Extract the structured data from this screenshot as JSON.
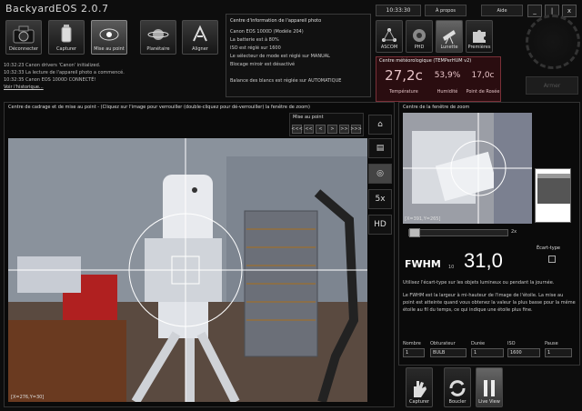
{
  "app": {
    "title": "BackyardEOS 2.0.7"
  },
  "toolbar": {
    "buttons": [
      {
        "label": "Déconnecter"
      },
      {
        "label": "Capturer"
      },
      {
        "label": "Mise au point"
      },
      {
        "label": "Planétaire"
      },
      {
        "label": "Aligner"
      }
    ]
  },
  "log": {
    "lines": [
      "10:32:23   Canon drivers 'Canon' initialized.",
      "10:32:33   La lecture de l'appareil photo a commencé.",
      "10:32:35   Canon EOS 1000D CONNECTÉ!"
    ],
    "history_link": "Voir l'historique..."
  },
  "info_panel": {
    "title": "Centre d'information de l'appareil photo",
    "lines": [
      "Canon EOS 1000D     (Modèle 204)",
      "La batterie est à 80%",
      "ISO est réglé sur 1600",
      "Le sélecteur de mode est réglé sur MANUAL",
      "Blocage miroir est désactivé",
      "",
      "Balance des blancs est réglée sur AUTOMATIQUE"
    ]
  },
  "header_right": {
    "time": "10:33:30",
    "about": "À propos",
    "help": "Aide",
    "win_min": "_",
    "win_max": "|",
    "win_close": "x"
  },
  "modules": [
    {
      "label": "ASCOM"
    },
    {
      "label": "PHD"
    },
    {
      "label": "Lunette"
    },
    {
      "label": "Premières"
    }
  ],
  "meteo": {
    "title": "Centre météorologique (TEMPerHUM v2)",
    "temperature": "27,2c",
    "temperature_label": "Température",
    "humidity": "53,9%",
    "humidity_label": "Humidité",
    "dewpoint": "17,0c",
    "dewpoint_label": "Point de Rosée"
  },
  "armer": {
    "label": "Armer"
  },
  "framing": {
    "title": "Centre de cadrage et de mise au point - (Cliquez sur l'image pour verrouiller (double-cliquez pour dé-verrouiller) la fenêtre de zoom)",
    "coords": "[X=276,Y=30]",
    "mise_title": "Mise au point",
    "mise_buttons": [
      "<<<",
      "<<",
      "<",
      ">",
      ">>",
      ">>>"
    ],
    "side_tools": [
      "⌂",
      "▤",
      "◎",
      "5x",
      "HD"
    ]
  },
  "zoom": {
    "title": "Centre de la fenêtre de zoom",
    "coords": "[X=391,Y=265]",
    "slider_value": "2x",
    "slider_position": 0.0
  },
  "fwhm": {
    "label": "FWHM",
    "sub": "10",
    "value": "31,0",
    "ecart_label": "Écart-type"
  },
  "description": {
    "p1": "Utilisez l'écart-type sur les objets lumineux ou pendant la journée.",
    "p2": "Le FWHM est la largeur à mi-hauteur de l'image de l'étoile. La mise au point est atteinte quand vous obtenez la valeur la plus basse pour la même étoile au fil du temps, ce qui indique une étoile plus fine."
  },
  "params": {
    "nombre_label": "Nombre",
    "nombre": "1",
    "obturateur_label": "Obturateur",
    "obturateur": "BULB",
    "duree_label": "Durée",
    "duree": "1",
    "iso_label": "ISO",
    "iso": "1600",
    "pause_label": "Pause",
    "pause": "1"
  },
  "bottom_buttons": [
    {
      "label": "Capturer"
    },
    {
      "label": "Boucler"
    },
    {
      "label": "Live View"
    }
  ]
}
